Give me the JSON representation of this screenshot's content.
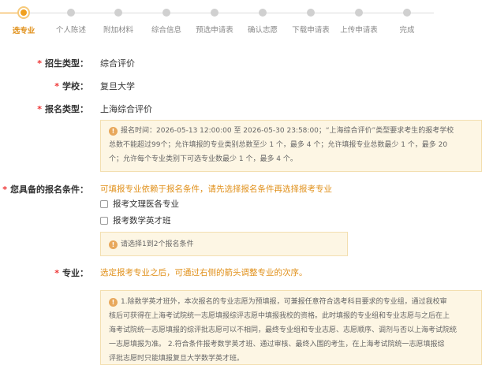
{
  "steps": [
    {
      "label": "选专业",
      "active": true
    },
    {
      "label": "个人陈述",
      "active": false
    },
    {
      "label": "附加材料",
      "active": false
    },
    {
      "label": "综合信息",
      "active": false
    },
    {
      "label": "预选申请表",
      "active": false
    },
    {
      "label": "确认志愿",
      "active": false
    },
    {
      "label": "下载申请表",
      "active": false
    },
    {
      "label": "上传申请表",
      "active": false
    },
    {
      "label": "完成",
      "active": false
    }
  ],
  "form": {
    "admission_type": {
      "label": "招生类型：",
      "value": "综合评价"
    },
    "school": {
      "label": "学校：",
      "value": "复旦大学"
    },
    "apply_type": {
      "label": "报名类型：",
      "value": "上海综合评价"
    },
    "time_notice": {
      "icon": "info-icon",
      "line1": "报名时间：2026-05-13 12:00:00 至 2026-05-30 23:58:00；“上海综合评价”类型要求考生的报考学校",
      "line2": "总数不能超过99个；允许填报的专业类别总数至少 1 个，最多 4 个；允许填报专业总数最少 1 个，最多 20",
      "line3": "个；允许每个专业类别下可选专业数最少 1 个，最多 4 个。"
    },
    "conditions": {
      "label": "您具备的报名条件：",
      "hint": "可填报专业依赖于报名条件，请先选择报名条件再选择报考专业",
      "options": [
        "报考文理医各专业",
        "报考数学英才班"
      ],
      "notice": "请选择1到2个报名条件"
    },
    "major": {
      "label": "专业：",
      "hint": "选定报考专业之后，可通过右侧的箭头调整专业的次序。",
      "notice_lines": [
        "1.除数学英才班外，本次报名的专业志愿为预填报，可兼报任意符合选考科目要求的专业组，通过我校审",
        "核后可获得在上海考试院统一志愿填报综评志愿中填报我校的资格。此时填报的专业组和专业志愿与之后在上",
        "海考试院统一志愿填报的综评批志愿可以不相同，最终专业组和专业志愿、志愿顺序、调剂与否以上海考试院统",
        "一志愿填报为准。 2.符合条件报考数学英才班、通过审核、最终入围的考生，在上海考试院统一志愿填报综",
        "评批志愿时只能填报复旦大学数学英才班。"
      ]
    }
  },
  "colors": {
    "accent": "#f0a020",
    "required": "#e33333",
    "notice_bg": "#fdf6e4"
  }
}
